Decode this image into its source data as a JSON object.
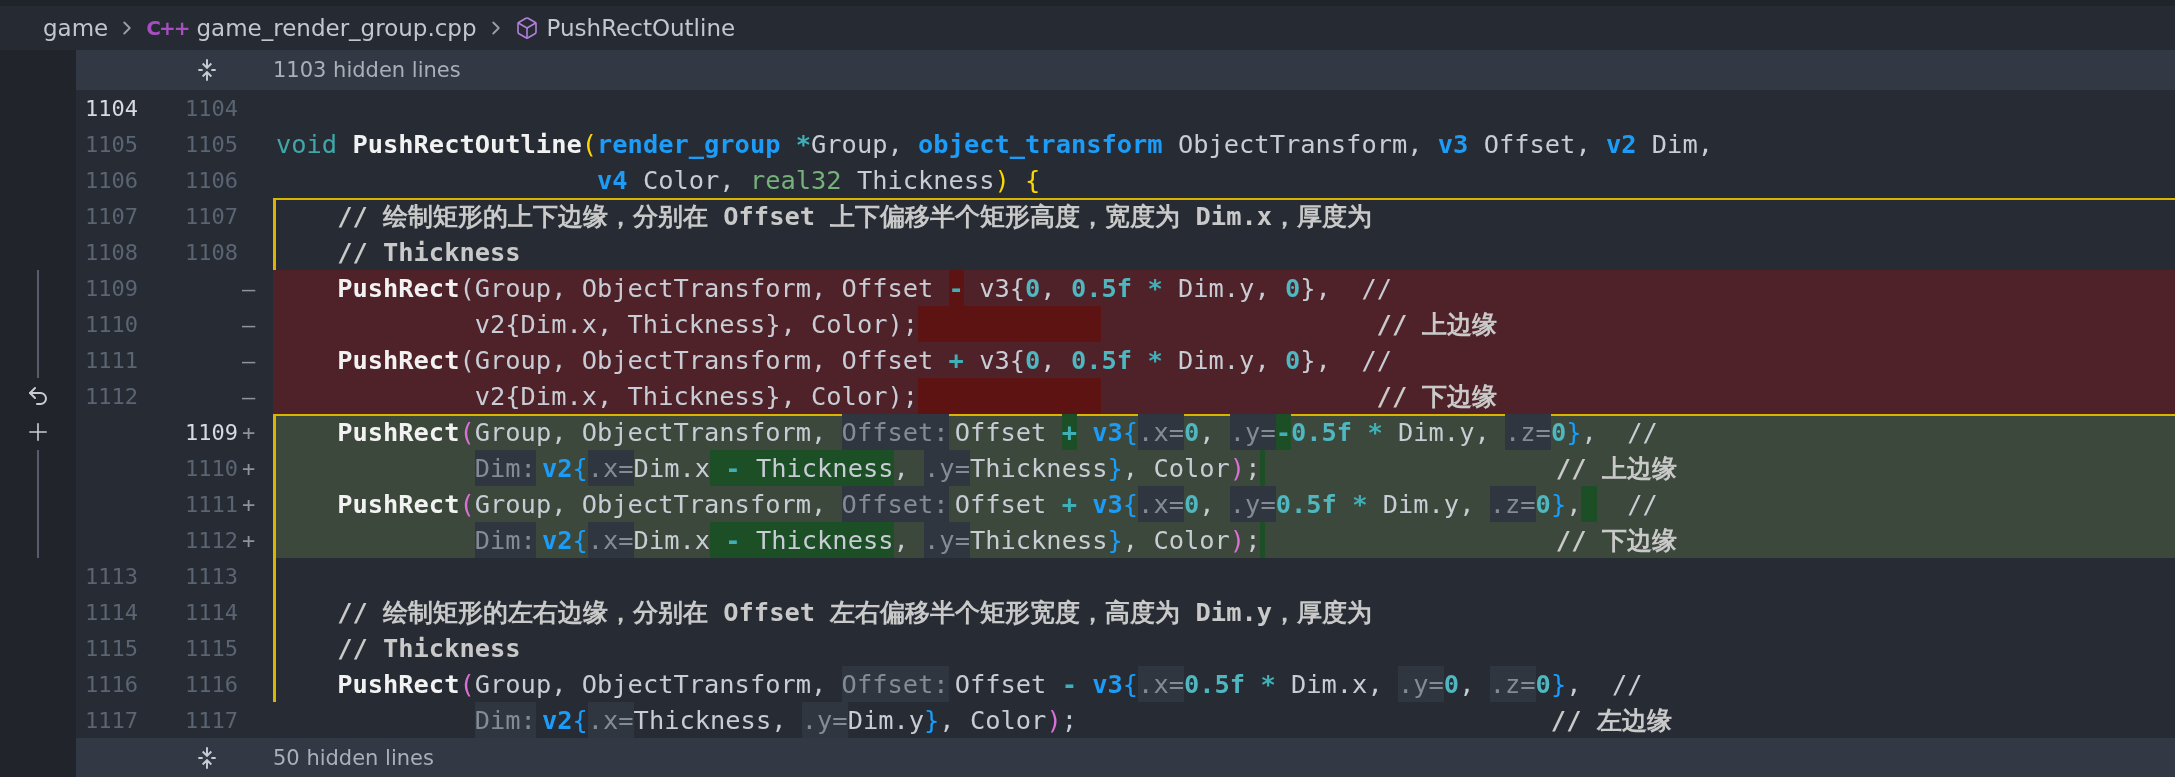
{
  "breadcrumb": [
    {
      "kind": "folder",
      "label": "game"
    },
    {
      "kind": "file",
      "icon": "C++",
      "label": "game_render_group.cpp"
    },
    {
      "kind": "symbol",
      "label": "PushRectOutline"
    }
  ],
  "hidden_top": {
    "label": "1103 hidden lines"
  },
  "lines": [
    {
      "kind": "context",
      "old": "1104",
      "new": "1104",
      "old_lit": true,
      "new_lit": false,
      "in_scope": false
    },
    {
      "kind": "context",
      "old": "1105",
      "new": "1105",
      "old_lit": false,
      "new_lit": false,
      "in_scope": false,
      "tokens": [
        {
          "kind": "keyword",
          "text": "void "
        },
        {
          "kind": "func",
          "text": "PushRectOutline"
        },
        {
          "kind": "bracket1",
          "text": "("
        },
        {
          "kind": "type",
          "text": "render_group"
        },
        {
          "kind": "op",
          "text": " *"
        },
        {
          "kind": "plain",
          "text": "Group, "
        },
        {
          "kind": "type",
          "text": "object_transform"
        },
        {
          "kind": "plain",
          "text": " ObjectTransform, "
        },
        {
          "kind": "type",
          "text": "v3"
        },
        {
          "kind": "plain",
          "text": " Offset, "
        },
        {
          "kind": "type",
          "text": "v2"
        },
        {
          "kind": "plain",
          "text": " Dim,"
        }
      ]
    },
    {
      "kind": "context",
      "old": "1106",
      "new": "1106",
      "old_lit": false,
      "new_lit": false,
      "in_scope": false,
      "tokens": [
        {
          "kind": "type",
          "text": "                     v4"
        },
        {
          "kind": "plain",
          "text": " Color, "
        },
        {
          "kind": "realtype",
          "text": "real32"
        },
        {
          "kind": "plain",
          "text": " Thickness"
        },
        {
          "kind": "bracket1",
          "text": ")"
        },
        {
          "kind": "bracket1",
          "text": " {"
        }
      ]
    },
    {
      "kind": "context",
      "old": "1107",
      "new": "1107",
      "old_lit": false,
      "new_lit": false,
      "in_scope": true,
      "tokens": [
        {
          "kind": "comment",
          "text": "    // 绘制矩形的上下边缘，分别在 Offset 上下偏移半个矩形高度，宽度为 Dim.x，厚度为"
        }
      ]
    },
    {
      "kind": "context",
      "old": "1108",
      "new": "1108",
      "old_lit": false,
      "new_lit": false,
      "in_scope": true,
      "tokens": [
        {
          "kind": "comment",
          "text": "    // Thickness"
        }
      ]
    },
    {
      "kind": "removed",
      "old": "1109",
      "marker": "—",
      "old_lit": false,
      "in_scope": false,
      "tokens": [
        {
          "kind": "func",
          "text": "    PushRect"
        },
        {
          "kind": "plain",
          "text": "(Group, ObjectTransform, Offset "
        },
        {
          "kind": "op",
          "text": "-",
          "changed": true
        },
        {
          "kind": "plain",
          "text": " v3{"
        },
        {
          "kind": "number",
          "text": "0"
        },
        {
          "kind": "plain",
          "text": ", "
        },
        {
          "kind": "number",
          "text": "0.5f"
        },
        {
          "kind": "op",
          "text": " *"
        },
        {
          "kind": "plain",
          "text": " Dim.y, "
        },
        {
          "kind": "number",
          "text": "0"
        },
        {
          "kind": "plain",
          "text": "},  //"
        }
      ]
    },
    {
      "kind": "removed",
      "old": "1110",
      "marker": "—",
      "old_lit": false,
      "in_scope": false,
      "tokens": [
        {
          "kind": "plain",
          "text": "             v2{Dim.x, Thickness}, Color);"
        },
        {
          "kind": "gap_wide",
          "changed": true
        },
        {
          "kind": "comment",
          "text": "                  // 上边缘"
        }
      ]
    },
    {
      "kind": "removed",
      "old": "1111",
      "marker": "—",
      "old_lit": false,
      "in_scope": false,
      "tokens": [
        {
          "kind": "func",
          "text": "    PushRect"
        },
        {
          "kind": "plain",
          "text": "(Group, ObjectTransform, Offset "
        },
        {
          "kind": "op",
          "text": "+"
        },
        {
          "kind": "plain",
          "text": " v3{"
        },
        {
          "kind": "number",
          "text": "0"
        },
        {
          "kind": "plain",
          "text": ", "
        },
        {
          "kind": "number",
          "text": "0.5f"
        },
        {
          "kind": "op",
          "text": " *"
        },
        {
          "kind": "plain",
          "text": " Dim.y, "
        },
        {
          "kind": "number",
          "text": "0"
        },
        {
          "kind": "plain",
          "text": "},  //"
        }
      ]
    },
    {
      "kind": "removed",
      "old": "1112",
      "marker": "—",
      "old_lit": false,
      "in_scope": false,
      "tokens": [
        {
          "kind": "plain",
          "text": "             v2{Dim.x, Thickness}, Color);"
        },
        {
          "kind": "gap_wide",
          "changed": true
        },
        {
          "kind": "comment",
          "text": "                  // 下边缘"
        }
      ]
    },
    {
      "kind": "added",
      "new": "1109",
      "marker": "+",
      "new_lit": true,
      "in_scope": true,
      "tokens": [
        {
          "kind": "func",
          "text": "    PushRect"
        },
        {
          "kind": "bracket2",
          "text": "("
        },
        {
          "kind": "plain",
          "text": "Group, ObjectTransform, "
        },
        {
          "kind": "hint_label",
          "text": "Offset:"
        },
        {
          "kind": "plain",
          "text": "Offset "
        },
        {
          "kind": "op",
          "text": "+",
          "changed": true
        },
        {
          "kind": "type",
          "text": " v3"
        },
        {
          "kind": "bracket3",
          "text": "{"
        },
        {
          "kind": "hint",
          "text": ".x="
        },
        {
          "kind": "number",
          "text": "0"
        },
        {
          "kind": "plain",
          "text": ", "
        },
        {
          "kind": "hint",
          "text": ".y="
        },
        {
          "kind": "op",
          "text": "-",
          "changed": true
        },
        {
          "kind": "number",
          "text": "0.5f"
        },
        {
          "kind": "op",
          "text": " *"
        },
        {
          "kind": "plain",
          "text": " Dim.y, "
        },
        {
          "kind": "hint",
          "text": ".z="
        },
        {
          "kind": "number",
          "text": "0"
        },
        {
          "kind": "bracket3",
          "text": "}"
        },
        {
          "kind": "plain",
          "text": ",  //"
        }
      ]
    },
    {
      "kind": "added",
      "new": "1110",
      "marker": "+",
      "new_lit": false,
      "in_scope": true,
      "tokens": [
        {
          "kind": "args_indent"
        },
        {
          "kind": "hint_label",
          "text": "Dim:"
        },
        {
          "kind": "type",
          "text": "v2"
        },
        {
          "kind": "bracket3",
          "text": "{"
        },
        {
          "kind": "hint",
          "text": ".x="
        },
        {
          "kind": "plain",
          "text": "Dim.x"
        },
        {
          "kind": "op",
          "text": " -",
          "changed": true
        },
        {
          "kind": "plain",
          "text": " Thickness",
          "changed": true
        },
        {
          "kind": "plain",
          "text": ", "
        },
        {
          "kind": "hint",
          "text": ".y="
        },
        {
          "kind": "plain",
          "text": "Thickness"
        },
        {
          "kind": "bracket3",
          "text": "}"
        },
        {
          "kind": "plain",
          "text": ", Color"
        },
        {
          "kind": "bracket2",
          "text": ")"
        },
        {
          "kind": "plain",
          "text": ";"
        },
        {
          "kind": "gap_thin",
          "changed": true
        },
        {
          "kind": "comment",
          "text": "                   // 上边缘"
        }
      ]
    },
    {
      "kind": "added",
      "new": "1111",
      "marker": "+",
      "new_lit": false,
      "in_scope": true,
      "tokens": [
        {
          "kind": "func",
          "text": "    PushRect"
        },
        {
          "kind": "bracket2",
          "text": "("
        },
        {
          "kind": "plain",
          "text": "Group, ObjectTransform, "
        },
        {
          "kind": "hint_label",
          "text": "Offset:"
        },
        {
          "kind": "plain",
          "text": "Offset "
        },
        {
          "kind": "op",
          "text": "+"
        },
        {
          "kind": "type",
          "text": " v3"
        },
        {
          "kind": "bracket3",
          "text": "{"
        },
        {
          "kind": "hint",
          "text": ".x="
        },
        {
          "kind": "number",
          "text": "0"
        },
        {
          "kind": "plain",
          "text": ", "
        },
        {
          "kind": "hint",
          "text": ".y="
        },
        {
          "kind": "number",
          "text": "0.5f"
        },
        {
          "kind": "op",
          "text": " *"
        },
        {
          "kind": "plain",
          "text": " Dim.y, "
        },
        {
          "kind": "hint",
          "text": ".z="
        },
        {
          "kind": "number",
          "text": "0"
        },
        {
          "kind": "bracket3",
          "text": "}"
        },
        {
          "kind": "plain",
          "text": ","
        },
        {
          "kind": "gap",
          "changed": true
        },
        {
          "kind": "plain",
          "text": "  //"
        }
      ]
    },
    {
      "kind": "added",
      "new": "1112",
      "marker": "+",
      "new_lit": false,
      "in_scope": true,
      "tokens": [
        {
          "kind": "args_indent"
        },
        {
          "kind": "hint_label",
          "text": "Dim:"
        },
        {
          "kind": "type",
          "text": "v2"
        },
        {
          "kind": "bracket3",
          "text": "{"
        },
        {
          "kind": "hint",
          "text": ".x="
        },
        {
          "kind": "plain",
          "text": "Dim.x"
        },
        {
          "kind": "op",
          "text": " -",
          "changed": true
        },
        {
          "kind": "plain",
          "text": " Thickness",
          "changed": true
        },
        {
          "kind": "plain",
          "text": ", "
        },
        {
          "kind": "hint",
          "text": ".y="
        },
        {
          "kind": "plain",
          "text": "Thickness"
        },
        {
          "kind": "bracket3",
          "text": "}"
        },
        {
          "kind": "plain",
          "text": ", Color"
        },
        {
          "kind": "bracket2",
          "text": ")"
        },
        {
          "kind": "plain",
          "text": ";"
        },
        {
          "kind": "gap_thin",
          "changed": true
        },
        {
          "kind": "comment",
          "text": "                   // 下边缘"
        }
      ]
    },
    {
      "kind": "context",
      "old": "1113",
      "new": "1113",
      "old_lit": false,
      "new_lit": false,
      "in_scope": true
    },
    {
      "kind": "context",
      "old": "1114",
      "new": "1114",
      "old_lit": false,
      "new_lit": false,
      "in_scope": true,
      "tokens": [
        {
          "kind": "comment",
          "text": "    // 绘制矩形的左右边缘，分别在 Offset 左右偏移半个矩形宽度，高度为 Dim.y，厚度为"
        }
      ]
    },
    {
      "kind": "context",
      "old": "1115",
      "new": "1115",
      "old_lit": false,
      "new_lit": false,
      "in_scope": true,
      "tokens": [
        {
          "kind": "comment",
          "text": "    // Thickness"
        }
      ]
    },
    {
      "kind": "context",
      "old": "1116",
      "new": "1116",
      "old_lit": false,
      "new_lit": false,
      "in_scope": true,
      "tokens": [
        {
          "kind": "func",
          "text": "    PushRect"
        },
        {
          "kind": "bracket2",
          "text": "("
        },
        {
          "kind": "plain",
          "text": "Group, ObjectTransform, "
        },
        {
          "kind": "hint_label",
          "text": "Offset:"
        },
        {
          "kind": "plain",
          "text": "Offset "
        },
        {
          "kind": "op",
          "text": "-"
        },
        {
          "kind": "type",
          "text": " v3"
        },
        {
          "kind": "bracket3",
          "text": "{"
        },
        {
          "kind": "hint",
          "text": ".x="
        },
        {
          "kind": "number",
          "text": "0.5f"
        },
        {
          "kind": "op",
          "text": " *"
        },
        {
          "kind": "plain",
          "text": " Dim.x, "
        },
        {
          "kind": "hint",
          "text": ".y="
        },
        {
          "kind": "number",
          "text": "0"
        },
        {
          "kind": "plain",
          "text": ", "
        },
        {
          "kind": "hint",
          "text": ".z="
        },
        {
          "kind": "number",
          "text": "0"
        },
        {
          "kind": "bracket3",
          "text": "}"
        },
        {
          "kind": "plain",
          "text": ",  //"
        }
      ]
    },
    {
      "kind": "context",
      "old": "1117",
      "new": "1117",
      "old_lit": false,
      "new_lit": false,
      "in_scope": false,
      "tokens": [
        {
          "kind": "args_indent"
        },
        {
          "kind": "hint_label",
          "text": "Dim:"
        },
        {
          "kind": "type",
          "text": "v2"
        },
        {
          "kind": "bracket3",
          "text": "{"
        },
        {
          "kind": "hint",
          "text": ".x="
        },
        {
          "kind": "plain",
          "text": "Thickness, "
        },
        {
          "kind": "hint",
          "text": ".y="
        },
        {
          "kind": "plain",
          "text": "Dim.y"
        },
        {
          "kind": "bracket3",
          "text": "}"
        },
        {
          "kind": "plain",
          "text": ", Color"
        },
        {
          "kind": "bracket2",
          "text": ")"
        },
        {
          "kind": "plain",
          "text": ";"
        },
        {
          "kind": "comment",
          "text": "                               // 左边缘"
        }
      ]
    }
  ],
  "hidden_bottom": {
    "label": "50 hidden lines"
  }
}
